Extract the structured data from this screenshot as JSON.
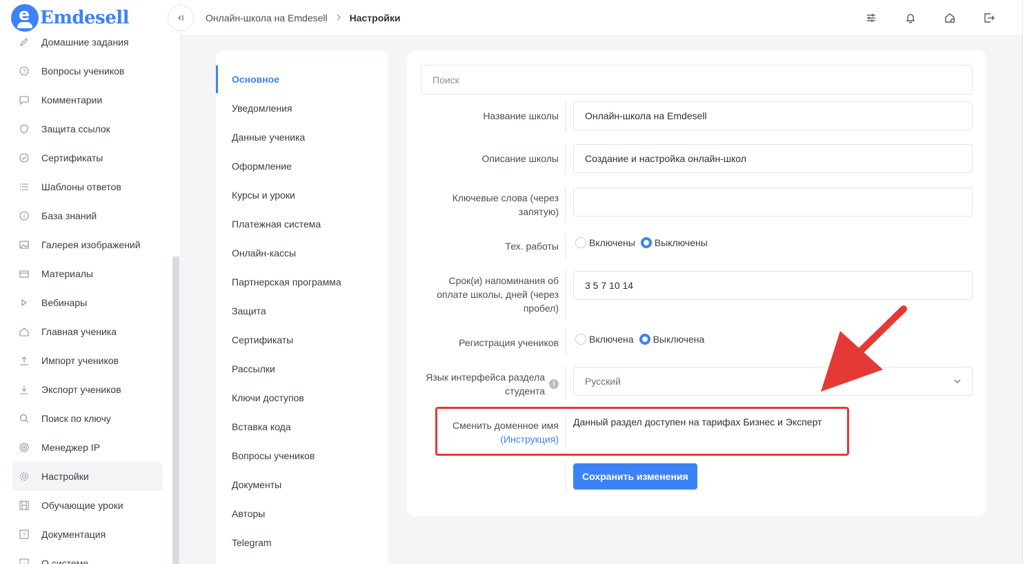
{
  "brand": {
    "logo_letter": "e",
    "name": "Emdesell"
  },
  "sidebar": {
    "items": [
      {
        "id": "homework",
        "label": "Домашние задания",
        "icon": "pencil-icon"
      },
      {
        "id": "student-questions",
        "label": "Вопросы учеников",
        "icon": "question-circle-icon"
      },
      {
        "id": "comments",
        "label": "Комментарии",
        "icon": "comment-icon"
      },
      {
        "id": "link-protection",
        "label": "Защита ссылок",
        "icon": "shield-icon"
      },
      {
        "id": "certificates",
        "label": "Сертификаты",
        "icon": "check-circle-icon"
      },
      {
        "id": "answer-templates",
        "label": "Шаблоны ответов",
        "icon": "list-icon"
      },
      {
        "id": "knowledge-base",
        "label": "База знаний",
        "icon": "info-circle-icon"
      },
      {
        "id": "image-gallery",
        "label": "Галерея изображений",
        "icon": "image-icon"
      },
      {
        "id": "materials",
        "label": "Материалы",
        "icon": "box-icon"
      },
      {
        "id": "webinars",
        "label": "Вебинары",
        "icon": "play-icon"
      },
      {
        "id": "student-home",
        "label": "Главная ученика",
        "icon": "home-icon"
      },
      {
        "id": "import-students",
        "label": "Импорт учеников",
        "icon": "upload-icon"
      },
      {
        "id": "export-students",
        "label": "Экспорт учеников",
        "icon": "download-icon"
      },
      {
        "id": "key-search",
        "label": "Поиск по ключу",
        "icon": "search-icon"
      },
      {
        "id": "ip-manager",
        "label": "Менеджер IP",
        "icon": "target-icon"
      },
      {
        "id": "settings",
        "label": "Настройки",
        "icon": "gear-icon"
      },
      {
        "id": "tutorials",
        "label": "Обучающие уроки",
        "icon": "film-icon"
      },
      {
        "id": "documentation",
        "label": "Документация",
        "icon": "help-square-icon"
      },
      {
        "id": "about",
        "label": "О системе",
        "icon": "info-square-icon"
      }
    ],
    "active": "settings"
  },
  "header": {
    "breadcrumb": [
      "Онлайн-школа на Emdesell",
      "Настройки"
    ],
    "icons": [
      "sliders-icon",
      "bell-icon",
      "home-settings-icon",
      "logout-icon"
    ]
  },
  "settings_menu": {
    "items": [
      "Основное",
      "Уведомления",
      "Данные ученика",
      "Оформление",
      "Курсы и уроки",
      "Платежная система",
      "Онлайн-кассы",
      "Партнерская программа",
      "Защита",
      "Сертификаты",
      "Рассылки",
      "Ключи доступов",
      "Вставка кода",
      "Вопросы учеников",
      "Документы",
      "Авторы",
      "Telegram"
    ],
    "active_index": 0
  },
  "form": {
    "search_placeholder": "Поиск",
    "school_name": {
      "label": "Название школы",
      "value": "Онлайн-школа на Emdesell"
    },
    "school_description": {
      "label": "Описание школы",
      "value": "Создание и настройка онлайн-школ"
    },
    "keywords": {
      "label_1": "Ключевые слова (через",
      "label_2": "запятую)",
      "value": ""
    },
    "maintenance": {
      "label": "Тех. работы",
      "option_on": "Включены",
      "option_off": "Выключены",
      "selected": "off"
    },
    "reminder": {
      "label_1": "Срок(и) напоминания об",
      "label_2": "оплате школы, дней (через",
      "label_3": "пробел)",
      "value": "3 5 7 10 14"
    },
    "registration": {
      "label": "Регистрация учеников",
      "option_on": "Включена",
      "option_off": "Выключена",
      "selected": "off"
    },
    "language": {
      "label_1": "Язык интерфейса раздела",
      "label_2": "студента",
      "info": "i",
      "value": "Русский"
    },
    "domain": {
      "label_1": "Сменить доменное имя",
      "link": "(Инструкция)",
      "note": "Данный раздел доступен на тарифах Бизнес и Эксперт"
    },
    "save_label": "Сохранить изменения"
  },
  "annotation": {
    "highlight_color": "#e53935",
    "arrow_color": "#e53935"
  },
  "colors": {
    "accent": "#3b82f6",
    "sidebar_active_bg": "#f3f4f6"
  }
}
